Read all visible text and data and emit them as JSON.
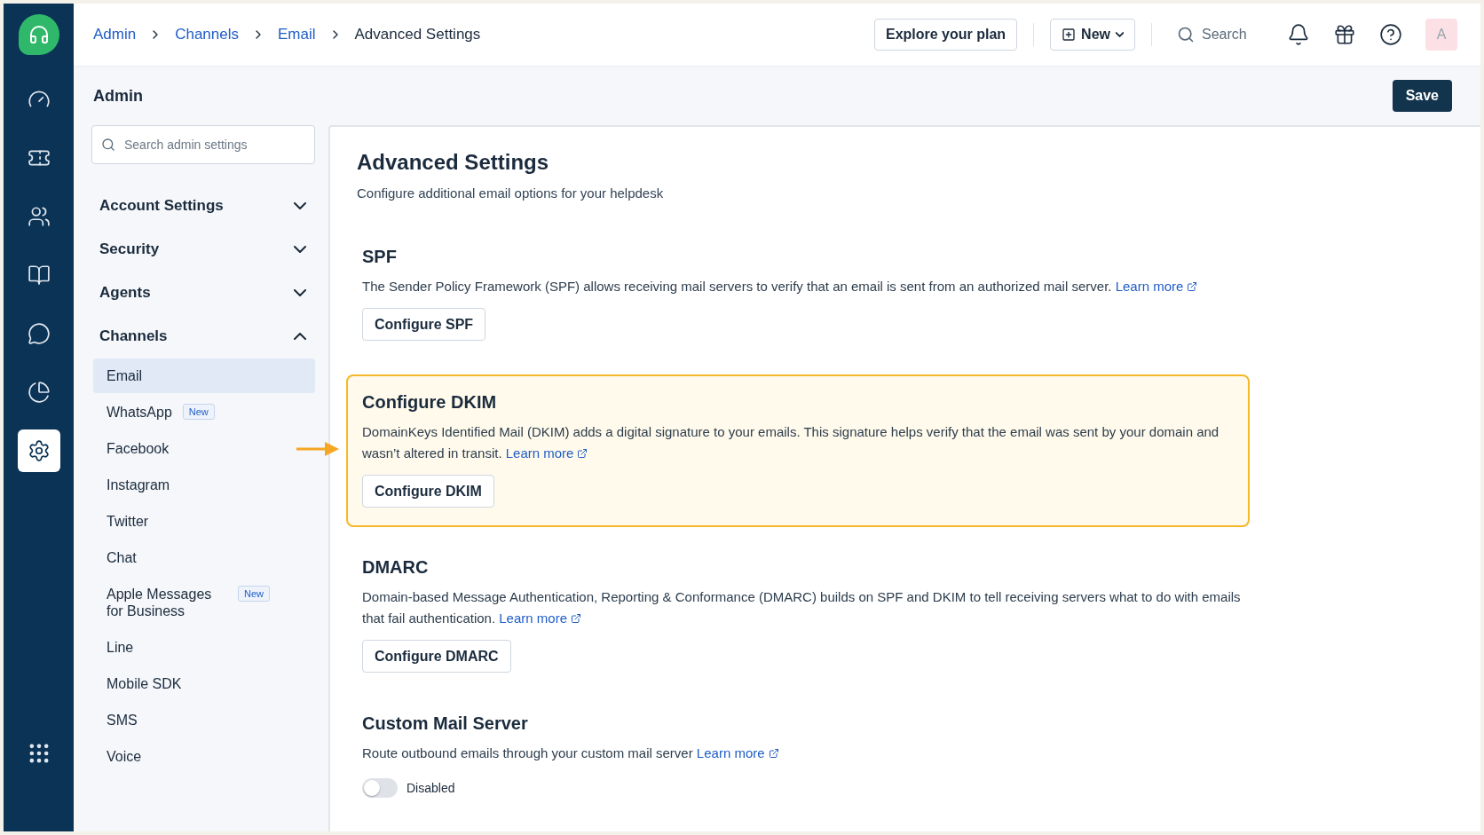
{
  "rail": {
    "items": [
      {
        "selected": false
      },
      {
        "selected": false
      },
      {
        "selected": false
      },
      {
        "selected": false
      },
      {
        "selected": false
      },
      {
        "selected": false
      },
      {
        "selected": true
      }
    ]
  },
  "topbar": {
    "breadcrumb": [
      {
        "label": "Admin",
        "link": true
      },
      {
        "label": "Channels",
        "link": true
      },
      {
        "label": "Email",
        "link": true
      },
      {
        "label": "Advanced Settings",
        "link": false
      }
    ],
    "plan_button": "Explore your plan",
    "new_button": "New",
    "search": {
      "placeholder": "Search"
    },
    "avatar": "A"
  },
  "header": {
    "title": "Admin",
    "save_button": "Save"
  },
  "nav": {
    "search": {
      "placeholder": "Search admin settings"
    },
    "sections": [
      {
        "label": "Account Settings",
        "expanded": false
      },
      {
        "label": "Security",
        "expanded": false
      },
      {
        "label": "Agents",
        "expanded": false
      },
      {
        "label": "Channels",
        "expanded": true,
        "children": [
          {
            "label": "Email",
            "selected": true
          },
          {
            "label": "WhatsApp",
            "selected": false,
            "badge": "New"
          },
          {
            "label": "Facebook",
            "selected": false
          },
          {
            "label": "Instagram",
            "selected": false
          },
          {
            "label": "Twitter",
            "selected": false
          },
          {
            "label": "Chat",
            "selected": false
          },
          {
            "label": "Apple Messages for Business",
            "selected": false,
            "badge": "New"
          },
          {
            "label": "Line",
            "selected": false
          },
          {
            "label": "Mobile SDK",
            "selected": false
          },
          {
            "label": "SMS",
            "selected": false
          },
          {
            "label": "Voice",
            "selected": false
          }
        ]
      }
    ]
  },
  "content": {
    "title": "Advanced Settings",
    "subtitle": "Configure additional email options for your helpdesk",
    "sections": [
      {
        "kind": "button",
        "highlighted": false,
        "title": "SPF",
        "description": "The Sender Policy Framework (SPF) allows receiving mail servers to verify that an email is sent from an authorized mail server.",
        "link": "Learn more",
        "button": "Configure SPF"
      },
      {
        "kind": "button",
        "highlighted": true,
        "title": "Configure DKIM",
        "description": "DomainKeys Identified Mail (DKIM) adds a digital signature to your emails. This signature helps verify that the email was sent by your domain and wasn’t altered in transit.",
        "link": "Learn more",
        "button": "Configure DKIM"
      },
      {
        "kind": "button",
        "highlighted": false,
        "title": "DMARC",
        "description": "Domain-based Message Authentication, Reporting & Conformance (DMARC) builds on SPF and DKIM to tell receiving servers what to do with emails that fail authentication.",
        "link": "Learn more",
        "button": "Configure DMARC"
      },
      {
        "kind": "toggle",
        "highlighted": false,
        "title": "Custom Mail Server",
        "description": "Route outbound emails through your custom mail server",
        "link": "Learn more",
        "toggle": {
          "on": false,
          "label": "Disabled"
        }
      }
    ]
  }
}
